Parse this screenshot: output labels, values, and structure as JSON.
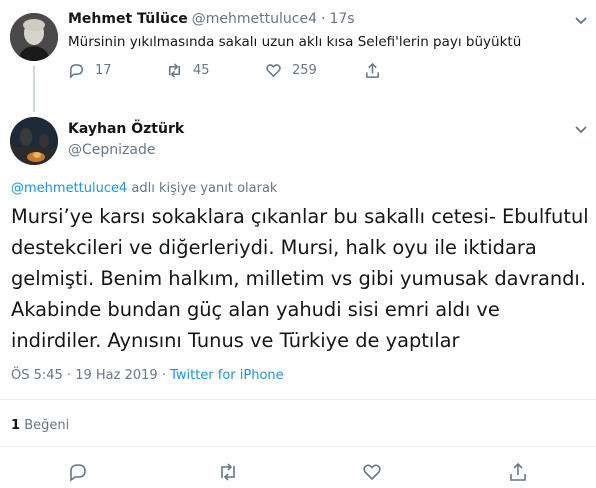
{
  "parent_tweet": {
    "name": "Mehmet Tülüce",
    "handle": "@mehmettuluce4",
    "time": "17s",
    "text": "Mürsinin yıkılmasında sakalı uzun aklı kısa Selefi'lerin payı büyüktü",
    "replies": "17",
    "retweets": "45",
    "likes": "259"
  },
  "main_tweet": {
    "name": "Kayhan Öztürk",
    "handle": "@Cepnizade",
    "reply_to_handle": "@mehmettuluce4",
    "reply_to_suffix": "adlı kişiye yanıt olarak",
    "text": "Mursi’ye karsı sokaklara çıkanlar bu sakallı cetesi- Ebulfutul destekcileri ve diğerleriydi. Mursi, halk oyu ile iktidara gelmişti. Benim halkım, milletim vs gibi yumusak davrandı. Akabinde bundan güç alan yahudi sisi emri aldı ve indirdiler. Aynısını Tunus ve Türkiye de yaptılar",
    "timestamp": "ÖS 5:45 · 19 Haz 2019 · ",
    "source": "Twitter for iPhone",
    "like_count": "1",
    "like_label": "Beğeni"
  },
  "icons": {
    "reply": "reply-icon",
    "retweet": "retweet-icon",
    "like": "heart-icon",
    "share": "share-icon",
    "more": "chevron-down-icon"
  },
  "colors": {
    "link": "#1b95e0",
    "secondary_text": "#657786",
    "divider": "#e6ecf0"
  }
}
